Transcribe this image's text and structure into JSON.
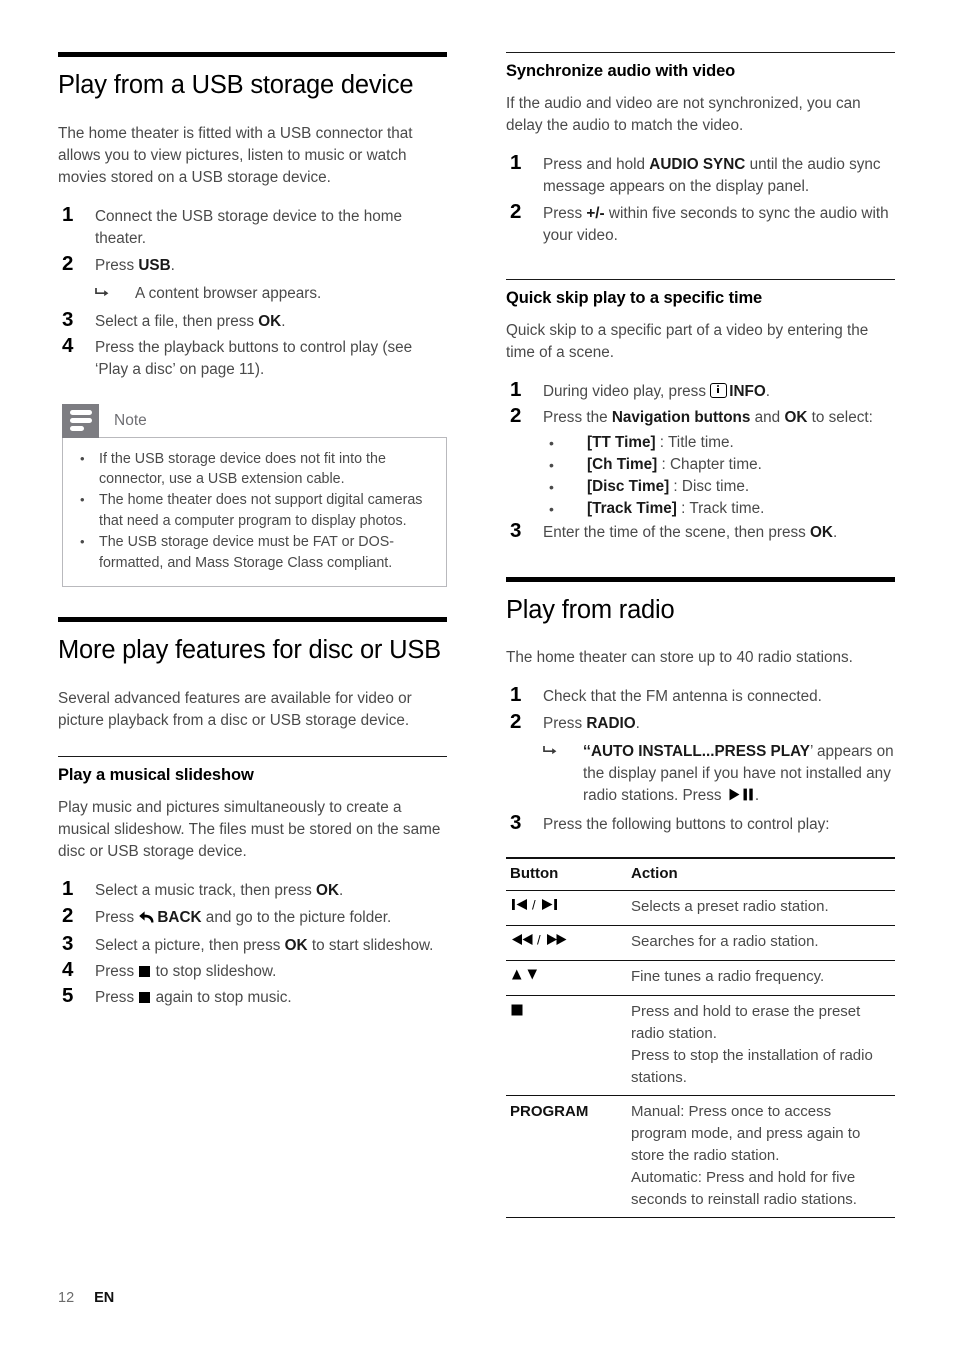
{
  "page": {
    "number": "12",
    "language": "EN"
  },
  "left_column": {
    "section1": {
      "title": "Play from a USB storage device",
      "intro": "The home theater is fitted with a USB connector that allows you to view pictures, listen to music or watch movies stored on a USB storage device.",
      "steps": [
        {
          "num": "1",
          "text": "Connect the USB storage device to the home theater."
        },
        {
          "num": "2",
          "text_pre": "Press ",
          "bold": "USB",
          "text_post": ".",
          "result": "A content browser appears."
        },
        {
          "num": "3",
          "text_pre": "Select a file, then press ",
          "bold": "OK",
          "text_post": "."
        },
        {
          "num": "4",
          "text": "Press the playback buttons to control play (see ‘Play a disc’ on page 11)."
        }
      ],
      "note": {
        "label": "Note",
        "items": [
          "If the USB storage device does not fit into the connector, use a USB extension cable.",
          "The home theater does not support digital cameras that need a computer program to display photos.",
          "The USB storage device must be FAT or DOS-formatted, and Mass Storage Class compliant."
        ]
      }
    },
    "section2": {
      "title": "More play features for disc or USB",
      "intro": "Several advanced features are available for video or picture playback from a disc or USB storage device.",
      "subsection": {
        "title": "Play a musical slideshow",
        "intro": "Play music and pictures simultaneously to create a musical slideshow. The files must be stored on the same disc or USB storage device.",
        "steps": [
          {
            "num": "1",
            "pre": "Select a music track, then press ",
            "bold": "OK",
            "post": "."
          },
          {
            "num": "2",
            "pre": "Press ",
            "icon": "back-icon",
            "bold": "BACK",
            "post": " and go to the picture folder."
          },
          {
            "num": "3",
            "pre": "Select a picture, then press ",
            "bold": "OK",
            "post": " to start slideshow."
          },
          {
            "num": "4",
            "pre": "Press ",
            "icon": "stop-icon",
            "post": " to stop slideshow."
          },
          {
            "num": "5",
            "pre": "Press ",
            "icon": "stop-icon",
            "post": " again to stop music."
          }
        ]
      }
    }
  },
  "right_column": {
    "section1": {
      "title": "Synchronize audio with video",
      "intro": "If the audio and video are not synchronized, you can delay the audio to match the video.",
      "steps": [
        {
          "num": "1",
          "pre": "Press and hold ",
          "bold": "AUDIO SYNC",
          "post": " until the audio sync message appears on the display panel."
        },
        {
          "num": "2",
          "pre": "Press ",
          "bold": "+/-",
          "post": " within five seconds to sync the audio with your video."
        }
      ]
    },
    "section2": {
      "title": "Quick skip play to a specific time",
      "intro": "Quick skip to a specific part of a video by entering the time of a scene.",
      "step1": {
        "num": "1",
        "pre": "During video play, press ",
        "icon": "info-icon",
        "bold": "INFO",
        "post": "."
      },
      "step2": {
        "num": "2",
        "pre": "Press the ",
        "bold1": "Navigation buttons",
        "mid": " and ",
        "bold2": "OK",
        "post": " to select:"
      },
      "options": [
        {
          "label": "[TT Time]",
          "desc": " : Title time."
        },
        {
          "label": "[Ch Time]",
          "desc": " : Chapter time."
        },
        {
          "label": "[Disc Time]",
          "desc": " : Disc time."
        },
        {
          "label": "[Track Time]",
          "desc": " : Track time."
        }
      ],
      "step3": {
        "num": "3",
        "pre": "Enter the time of the scene, then press ",
        "bold": "OK",
        "post": "."
      }
    },
    "section3": {
      "title": "Play from radio",
      "intro": "The home theater can store up to 40 radio stations.",
      "step1": {
        "num": "1",
        "text": "Check that the FM antenna is connected."
      },
      "step2": {
        "num": "2",
        "pre": "Press ",
        "bold": "RADIO",
        "post": "."
      },
      "step2_result": {
        "quote_open": "‘‘",
        "bold": "AUTO INSTALL...PRESS PLAY",
        "quote_close": "’",
        "text": " appears on the display panel if you have not installed any radio stations. Press ",
        "icon": "play-pause-icon",
        "end": "."
      },
      "step3": {
        "num": "3",
        "text": "Press the following buttons to control play:"
      },
      "table": {
        "headers": [
          "Button",
          "Action"
        ],
        "rows": [
          {
            "button": "prev-next-icons",
            "button_text": "◀◀▶▶",
            "action": [
              "Selects a preset radio station."
            ]
          },
          {
            "button": "rewind-forward-icons",
            "button_text": "",
            "action": [
              "Searches for a radio station."
            ]
          },
          {
            "button": "up-down-icons",
            "button_text": "▲▼",
            "action": [
              "Fine tunes a radio frequency."
            ]
          },
          {
            "button": "stop-icon",
            "button_text": "",
            "action": [
              "Press and hold to erase the preset radio station.",
              "Press to stop the installation of radio stations."
            ]
          },
          {
            "button": "program-label",
            "button_text": "PROGRAM",
            "action": [
              "Manual: Press once to access program mode, and press again to store the radio station.",
              "Automatic: Press and hold for five seconds to reinstall radio stations."
            ]
          }
        ]
      }
    }
  },
  "symbols": {
    "hook_arrow": "↳",
    "bullet": "•",
    "prev": "⏮",
    "next": "⏭",
    "rewind": "⏪",
    "forward": "⏩",
    "up": "▲",
    "down": "▼",
    "slash": "/"
  },
  "colors": {
    "heading": "#000000",
    "body": "#4a4a4a",
    "note_tab": "#7d7d82",
    "note_border": "#b9b9bd",
    "rule": "#111111"
  }
}
